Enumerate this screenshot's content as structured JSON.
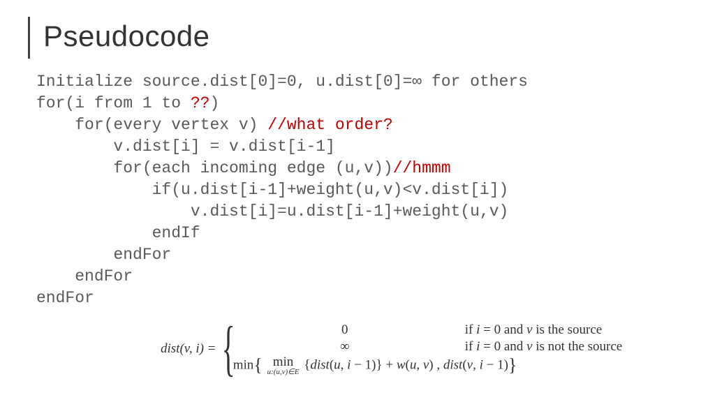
{
  "title": "Pseudocode",
  "code": {
    "l1a": "Initialize source.dist[0]=0, u.dist[0]=",
    "l1b": "∞",
    "l1c": " for others",
    "l2a": "for(i from 1 to ",
    "l2b": "??",
    "l2c": ")",
    "l3a": "    for(every vertex v) ",
    "l3b": "//what order?",
    "l4": "        v.dist[i] = v.dist[i-1]",
    "l5a": "        for(each incoming edge (u,v))",
    "l5b": "//hmmm",
    "l6": "            if(u.dist[i-1]+weight(u,v)<v.dist[i])",
    "l7": "                v.dist[i]=u.dist[i-1]+weight(u,v)",
    "l8": "            endIf",
    "l9": "        endFor",
    "l10": "    endFor",
    "l11": "endFor"
  },
  "formula": {
    "lhs": "dist(v, i) =",
    "case1_val": "0",
    "case1_cond": "if i = 0 and v is the source",
    "case2_val": "∞",
    "case2_cond": "if i = 0 and v is not the source",
    "case3_min": "min",
    "case3_inner_min_top": "min",
    "case3_inner_min_bot": "u:(u,v)∈E",
    "case3_body_a": "{dist(u, i − 1)} + w(u, v) , dist(v, i − 1)"
  }
}
